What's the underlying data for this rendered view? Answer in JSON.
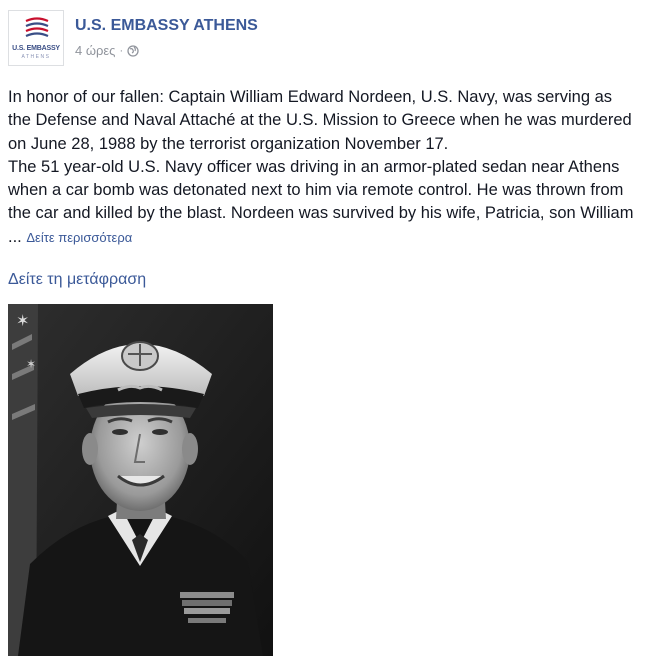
{
  "page": {
    "name": "U.S. EMBASSY ATHENS",
    "avatar_line1": "U.S. EMBASSY",
    "avatar_line2": "ATHENS",
    "timestamp": "4 ώρες",
    "separator": "·",
    "privacy_icon": "globe-icon"
  },
  "post": {
    "paragraph1": "In honor of our fallen: Captain William Edward Nordeen, U.S. Navy, was serving as the Defense and Naval Attaché at the U.S. Mission to Greece when he was murdered on June 28, 1988 by the terrorist organization November 17.",
    "paragraph2": "The 51 year-old U.S. Navy officer was driving in an armor-plated sedan near Athens when a car bomb was detonated next to him via remote control. He was thrown from the car and killed by the blast. Nordeen was survived by his wife, Patricia, son William ...",
    "see_more": "Δείτε περισσότερα",
    "see_translation": "Δείτε τη μετάφραση"
  },
  "colors": {
    "link": "#3b5998",
    "text": "#141823",
    "meta": "#90949c",
    "logo_red": "#c8102e",
    "logo_blue": "#3a4e86"
  }
}
